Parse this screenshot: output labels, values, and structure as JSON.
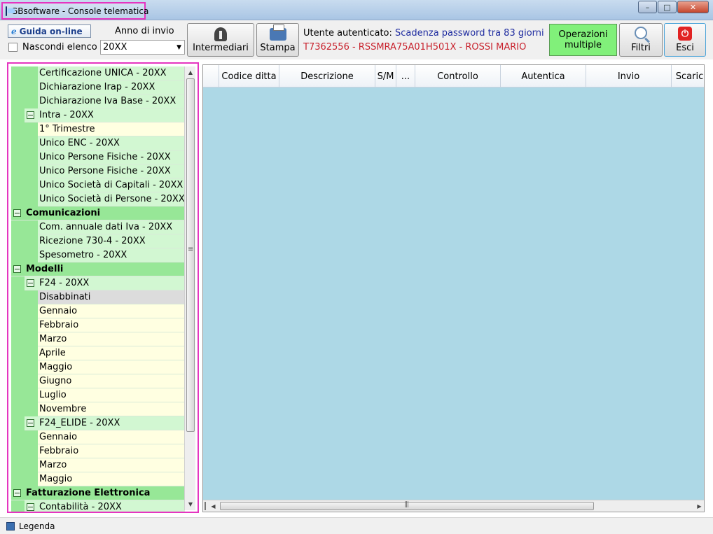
{
  "window": {
    "title": "GBsoftware - Console telematica",
    "controls": {
      "minimize": "–",
      "maximize": "□",
      "close": "✕"
    }
  },
  "toolbar": {
    "guida_label": "Guida on-line",
    "nascondi_label": "Nascondi elenco",
    "anno_label": "Anno di invio",
    "anno_value": "20XX",
    "intermediari_label": "Intermediari",
    "stampa_label": "Stampa",
    "user_prefix": "Utente autenticato:",
    "password_notice": "Scadenza password tra 83 giorni",
    "user_identity": "T7362556 - RSSMRA75A01H501X - ROSSI MARIO",
    "operazioni_line1": "Operazioni",
    "operazioni_line2": "multiple",
    "filtri_label": "Filtri",
    "esci_label": "Esci",
    "colors": {
      "operazioni_bg": "#81f07a",
      "user_red": "#c8212c",
      "user_blue": "#1f2ca0"
    }
  },
  "tree": {
    "items": [
      {
        "label": "Certificazione UNICA - 20XX",
        "level": 2,
        "kind": "grp"
      },
      {
        "label": "Dichiarazione Irap - 20XX",
        "level": 2,
        "kind": "grp"
      },
      {
        "label": "Dichiarazione Iva Base - 20XX",
        "level": 2,
        "kind": "grp"
      },
      {
        "label": "Intra - 20XX",
        "level": 1,
        "kind": "grp",
        "toggle": true
      },
      {
        "label": "1° Trimestre",
        "level": 2,
        "kind": "leaf"
      },
      {
        "label": "Unico ENC - 20XX",
        "level": 2,
        "kind": "grp"
      },
      {
        "label": "Unico Persone Fisiche - 20XX",
        "level": 2,
        "kind": "grp"
      },
      {
        "label": "Unico Persone Fisiche - 20XX",
        "level": 2,
        "kind": "grp"
      },
      {
        "label": "Unico Società di Capitali - 20XX",
        "level": 2,
        "kind": "grp"
      },
      {
        "label": "Unico Società di Persone - 20XX",
        "level": 2,
        "kind": "grp"
      },
      {
        "label": "Comunicazioni",
        "level": 0,
        "kind": "cat",
        "toggle": true
      },
      {
        "label": "Com. annuale dati Iva - 20XX",
        "level": 2,
        "kind": "grp"
      },
      {
        "label": "Ricezione 730-4 - 20XX",
        "level": 2,
        "kind": "grp"
      },
      {
        "label": "Spesometro - 20XX",
        "level": 2,
        "kind": "grp"
      },
      {
        "label": "Modelli",
        "level": 0,
        "kind": "cat",
        "toggle": true
      },
      {
        "label": "F24 - 20XX",
        "level": 1,
        "kind": "grp",
        "toggle": true
      },
      {
        "label": "Disabbinati",
        "level": 2,
        "kind": "sel"
      },
      {
        "label": "Gennaio",
        "level": 2,
        "kind": "leaf"
      },
      {
        "label": "Febbraio",
        "level": 2,
        "kind": "leaf"
      },
      {
        "label": "Marzo",
        "level": 2,
        "kind": "leaf"
      },
      {
        "label": "Aprile",
        "level": 2,
        "kind": "leaf"
      },
      {
        "label": "Maggio",
        "level": 2,
        "kind": "leaf"
      },
      {
        "label": "Giugno",
        "level": 2,
        "kind": "leaf"
      },
      {
        "label": "Luglio",
        "level": 2,
        "kind": "leaf"
      },
      {
        "label": "Novembre",
        "level": 2,
        "kind": "leaf"
      },
      {
        "label": "F24_ELIDE - 20XX",
        "level": 1,
        "kind": "grp",
        "toggle": true
      },
      {
        "label": "Gennaio",
        "level": 2,
        "kind": "leaf"
      },
      {
        "label": "Febbraio",
        "level": 2,
        "kind": "leaf"
      },
      {
        "label": "Marzo",
        "level": 2,
        "kind": "leaf"
      },
      {
        "label": "Maggio",
        "level": 2,
        "kind": "leaf"
      },
      {
        "label": "Fatturazione Elettronica",
        "level": 0,
        "kind": "cat",
        "toggle": true
      },
      {
        "label": "Contabilità - 20XX",
        "level": 1,
        "kind": "grp",
        "toggle": true
      }
    ]
  },
  "grid": {
    "columns": [
      {
        "label": "",
        "key": "sel"
      },
      {
        "label": "Codice ditta",
        "key": "codice"
      },
      {
        "label": "Descrizione",
        "key": "descrizione"
      },
      {
        "label": "S/M",
        "key": "sm"
      },
      {
        "label": "...",
        "key": "more"
      },
      {
        "label": "Controllo",
        "key": "controllo"
      },
      {
        "label": "Autentica",
        "key": "autentica"
      },
      {
        "label": "Invio",
        "key": "invio"
      },
      {
        "label": "Scarico",
        "key": "scarico"
      }
    ],
    "background": "#add8e6"
  },
  "statusbar": {
    "legend_label": "Legenda"
  },
  "icons": {
    "app": "app-icon",
    "guida": "ie-icon",
    "intermediari": "person-icon",
    "stampa": "printer-icon",
    "filtri": "magnifier-icon",
    "esci": "power-icon",
    "legend": "legend-icon"
  }
}
